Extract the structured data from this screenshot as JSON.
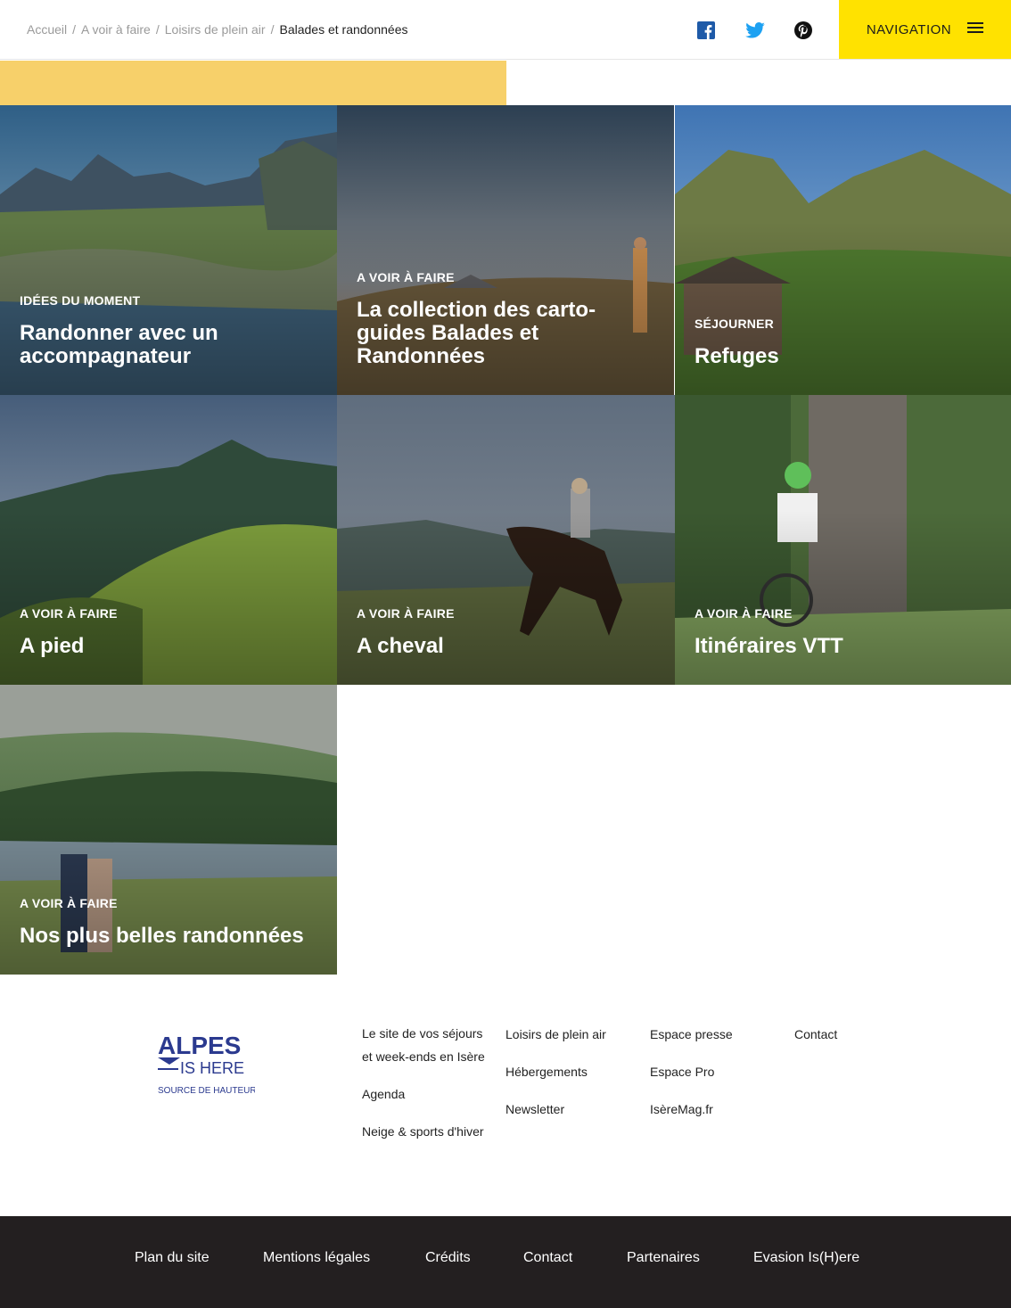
{
  "breadcrumb": {
    "items": [
      "Accueil",
      "A voir à faire",
      "Loisirs de plein air"
    ],
    "current": "Balades et randonnées"
  },
  "social": {
    "facebook": "facebook-icon",
    "twitter": "twitter-icon",
    "pinterest": "pinterest-icon"
  },
  "navigation": {
    "label": "NAVIGATION",
    "icon": "hamburger-menu-icon",
    "color": "#ffe200"
  },
  "band_color": "#f7d06a",
  "tiles": [
    {
      "category": "IDÉES DU MOMENT",
      "title": "Randonner avec un accompagnateur"
    },
    {
      "category": "A VOIR À FAIRE",
      "title": "La collection des carto-guides Balades et Randonnées"
    },
    {
      "category": "SÉJOURNER",
      "title": "Refuges"
    },
    {
      "category": "A VOIR À FAIRE",
      "title": "A pied"
    },
    {
      "category": "A VOIR À FAIRE",
      "title": "A cheval"
    },
    {
      "category": "A VOIR À FAIRE",
      "title": "Itinéraires VTT"
    },
    {
      "category": "A VOIR À FAIRE",
      "title": "Nos plus belles randonnées"
    }
  ],
  "logo": {
    "line1": "ALPES",
    "line2": "IS HERE",
    "tagline": "SOURCE DE HAUTEUR",
    "color": "#2b3a8f"
  },
  "footer_links": {
    "col1": [
      "Le site de vos séjours",
      "et week-ends en Isère",
      "Agenda",
      "Neige & sports d'hiver"
    ],
    "col2": [
      "Loisirs de plein air",
      "Hébergements",
      "Newsletter"
    ],
    "col3": [
      "Espace presse",
      "Espace Pro",
      "IsèreMag.fr"
    ],
    "col4": [
      "Contact"
    ]
  },
  "bottom_links": [
    "Plan du site",
    "Mentions légales",
    "Crédits",
    "Contact",
    "Partenaires",
    "Evasion Is(H)ere"
  ],
  "bottom_color": "#231f20"
}
